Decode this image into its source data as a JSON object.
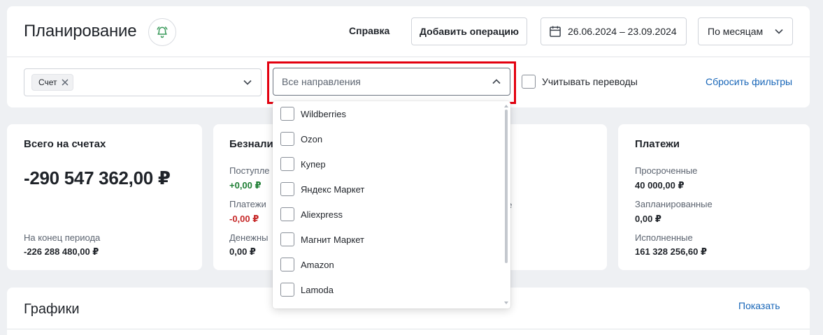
{
  "header": {
    "title": "Планирование",
    "help_label": "Справка",
    "add_operation_label": "Добавить операцию",
    "date_range": "26.06.2024 – 23.09.2024",
    "period": "По месяцам"
  },
  "filters": {
    "account_chip": "Счет",
    "direction_placeholder": "Все направления",
    "transfers_label": "Учитывать переводы",
    "reset_label": "Сбросить фильтры"
  },
  "directions_dropdown": {
    "options": [
      "Wildberries",
      "Ozon",
      "Купер",
      "Яндекс Маркет",
      "Aliexpress",
      "Магнит Маркет",
      "Amazon",
      "Lamoda"
    ]
  },
  "summary": {
    "total": {
      "title": "Всего на счетах",
      "value": "-290 547 362,00 ₽",
      "end_label": "На конец периода",
      "end_value": "-226 288 480,00 ₽"
    },
    "cashless": {
      "title": "Безнали",
      "income_label": "Поступле",
      "income_value": "+0,00 ₽",
      "payments_label": "Платежи",
      "payments_value": "-0,00 ₽",
      "money_label": "Денежны",
      "money_value": "0,00 ₽",
      "right_fragment": "не"
    },
    "payments": {
      "title": "Платежи",
      "overdue_label": "Просроченные",
      "overdue_value": "40 000,00 ₽",
      "planned_label": "Запланированные",
      "planned_value": "0,00 ₽",
      "done_label": "Исполненные",
      "done_value": "161 328 256,60 ₽"
    }
  },
  "charts": {
    "title": "Графики",
    "show_label": "Показать"
  },
  "colors": {
    "link": "#1866b8",
    "positive": "#1e7e34",
    "negative": "#c62828",
    "highlight": "#e3000f",
    "bell": "#3a9a5b"
  }
}
